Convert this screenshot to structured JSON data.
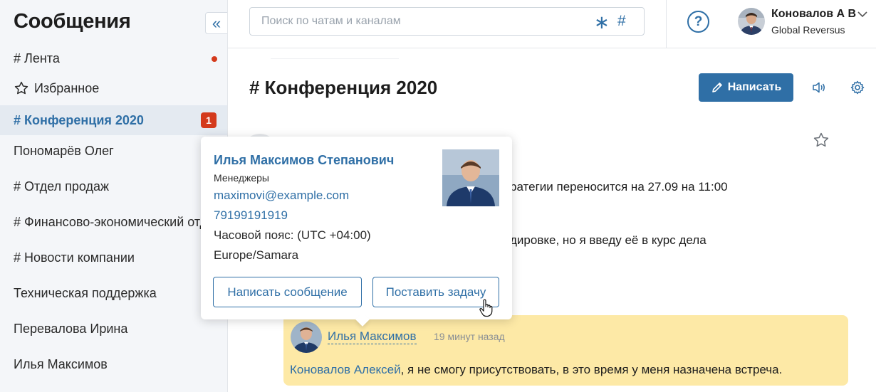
{
  "sidebar": {
    "title": "Сообщения",
    "collapse_glyph": "«",
    "items": [
      {
        "label": "# Лента",
        "icon": "",
        "unread_dot": true
      },
      {
        "label": "Избранное",
        "icon": "star-icon"
      },
      {
        "label": "# Конференция 2020",
        "active": true,
        "count": "1"
      },
      {
        "label": "Пономарёв Олег"
      },
      {
        "label": "# Отдел продаж"
      },
      {
        "label": "# Финансово-экономический отдел"
      },
      {
        "label": "# Новости компании"
      },
      {
        "label": "Техническая поддержка"
      },
      {
        "label": "Перевалова Ирина"
      },
      {
        "label": "Илья Максимов"
      }
    ]
  },
  "search": {
    "placeholder": "Поиск по чатам и каналам",
    "asterisk_glyph": "∗",
    "hash_glyph": "#"
  },
  "topbar": {
    "help_glyph": "?",
    "user_name": "Коновалов А В",
    "user_org": "Global Reversus"
  },
  "channel": {
    "title": "# Конференция 2020",
    "write_label": "Написать"
  },
  "messages": {
    "line1": "ратегии переносится на 27.09 на 11:00",
    "line2": "дировке, но я введу её в курс дела"
  },
  "reply": {
    "author": "Илья Максимов",
    "time": "19 минут назад",
    "mention": "Коновалов Алексей",
    "text": ", я не смогу присутствовать, в это время у меня назначена встреча."
  },
  "popup": {
    "name": "Илья Максимов Степанович",
    "department": "Менеджеры",
    "email": "maximovi@example.com",
    "phone": "79199191919",
    "timezone": "Часовой пояс: (UTC +04:00)",
    "region": "Europe/Samara",
    "message_button": "Написать сообщение",
    "task_button": "Поставить задачу"
  },
  "colors": {
    "accent": "#2f6fa6",
    "badge": "#d43a1c",
    "reply_bg": "#fde9a6",
    "sidebar_bg": "#f4f6f9"
  }
}
